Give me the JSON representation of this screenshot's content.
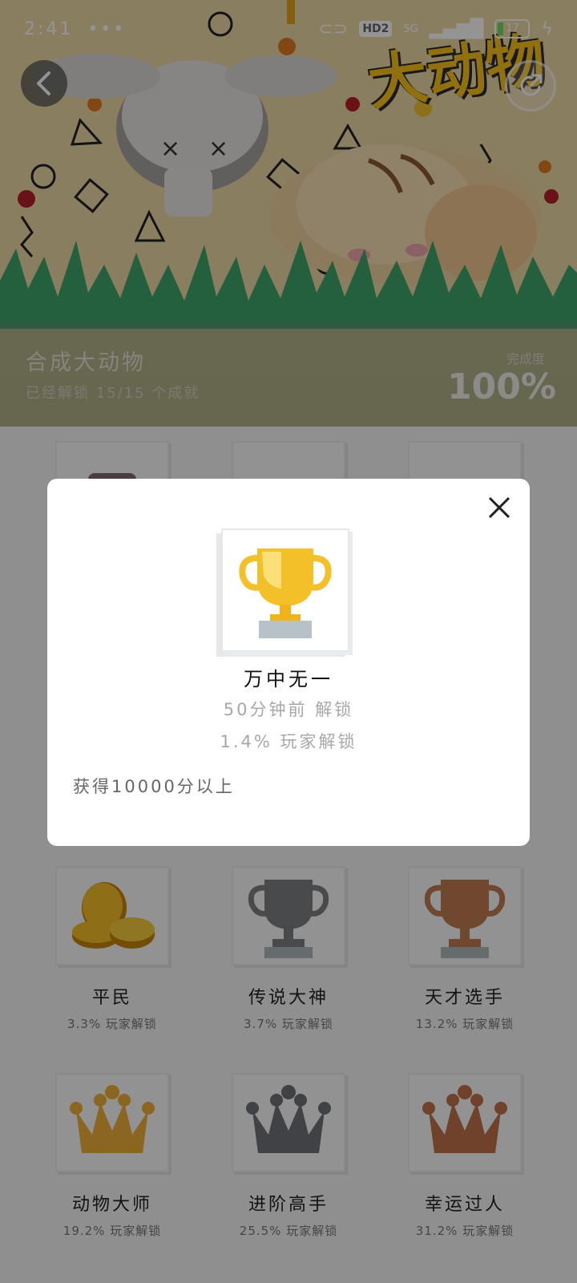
{
  "status_bar": {
    "time": "2:41",
    "dots": "•••",
    "hd_badge": "HD2",
    "network": "5G",
    "battery": "17"
  },
  "hero": {
    "logo_text": "大动物",
    "game_title": "合成大动物",
    "unlocked_text": "已经解锁 15/15 个成就",
    "completion_label": "完成度",
    "completion_value": "100%",
    "completion_fraction": 1.0
  },
  "achievements": [
    {
      "name": "平民",
      "percent": "3.3% 玩家解锁",
      "icon": "coins-icon"
    },
    {
      "name": "传说大神",
      "percent": "3.7% 玩家解锁",
      "icon": "silver-trophy-icon"
    },
    {
      "name": "天才选手",
      "percent": "13.2% 玩家解锁",
      "icon": "bronze-trophy-icon"
    },
    {
      "name": "动物大师",
      "percent": "19.2% 玩家解锁",
      "icon": "gold-crown-icon"
    },
    {
      "name": "进阶高手",
      "percent": "25.5% 玩家解锁",
      "icon": "silver-crown-icon"
    },
    {
      "name": "幸运过人",
      "percent": "31.2% 玩家解锁",
      "icon": "bronze-crown-icon"
    }
  ],
  "modal": {
    "title": "万中无一",
    "unlock_time": "50分钟前 解锁",
    "unlock_ratio": "1.4% 玩家解锁",
    "description": "获得10000分以上",
    "icon": "gold-trophy-icon"
  },
  "colors": {
    "gold": "#f4c02a",
    "silver": "#8a8d90",
    "bronze": "#c9825a",
    "hero_info_bg": "#6e8c78"
  }
}
